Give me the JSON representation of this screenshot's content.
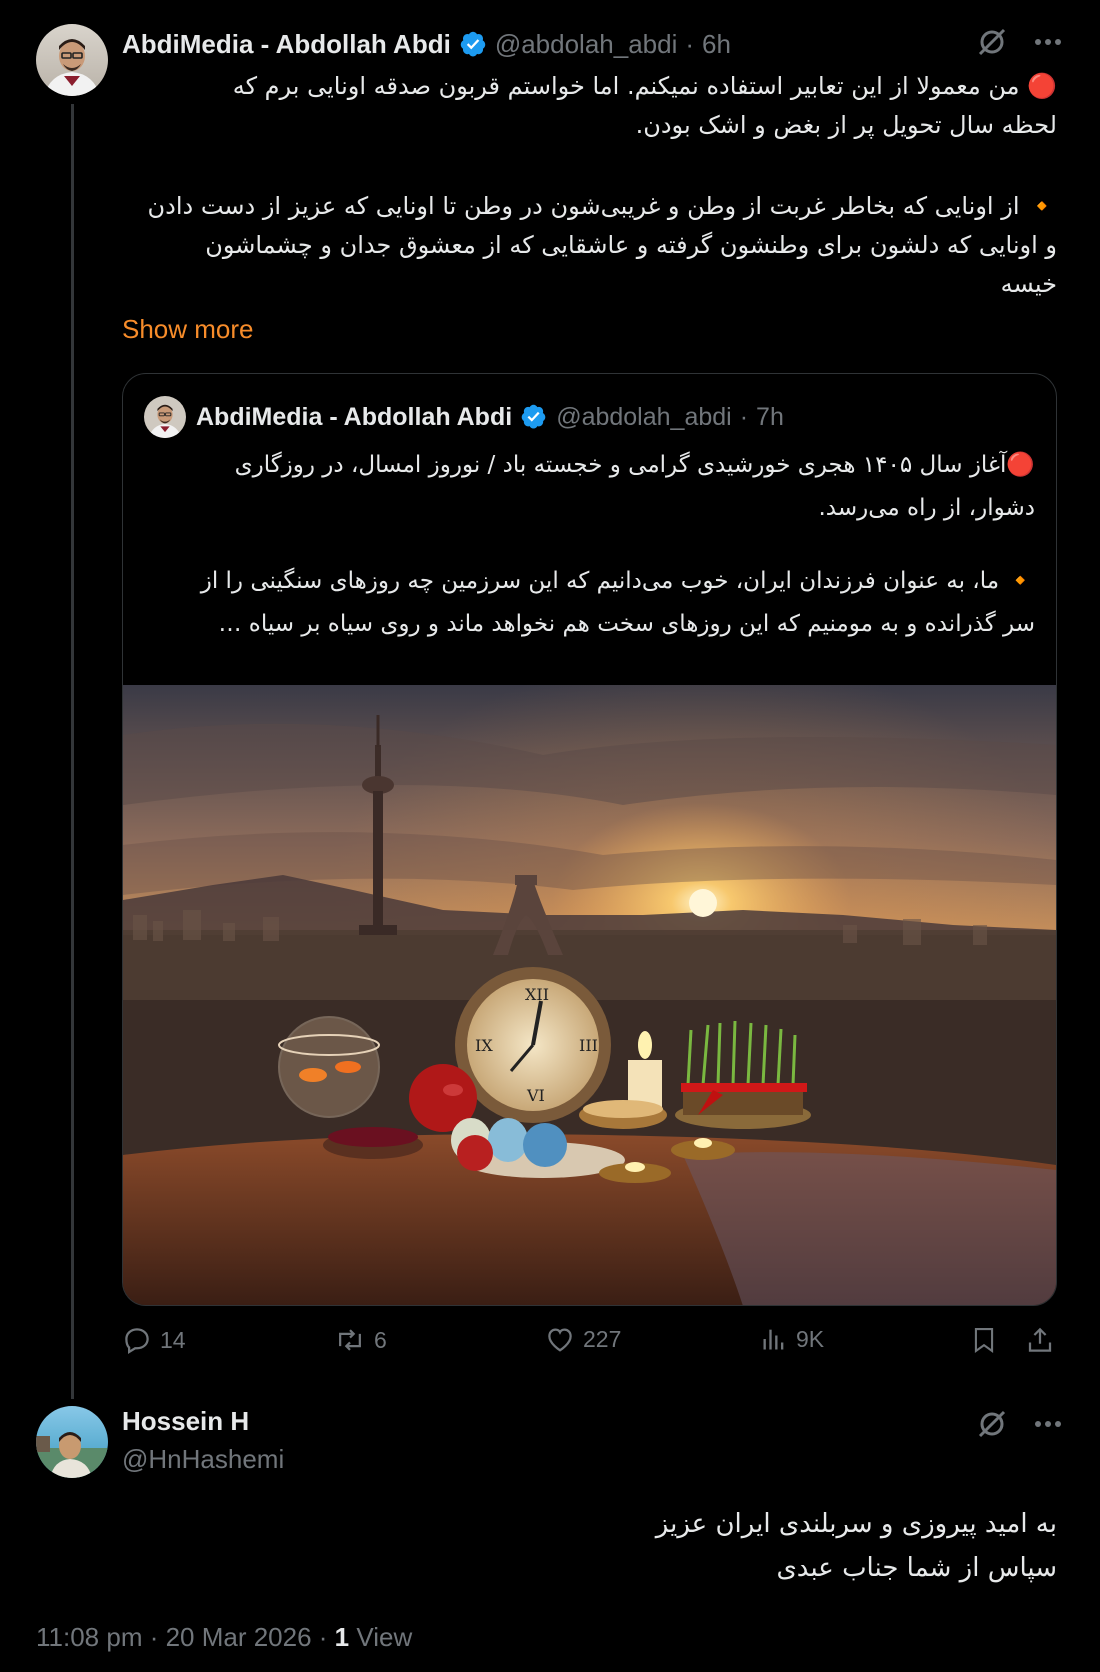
{
  "post": {
    "author_name": "AbdiMedia - Abdollah Abdi",
    "handle": "@abdolah_abdi",
    "separator": "·",
    "time": "6h",
    "lines": [
      "🔴 من معمولا از این تعابیر استفاده نمیکنم. اما خواستم قربون صدقه اونایی برم که",
      "لحظه سال تحویل پر از بغض و اشک بودن.",
      "🔸 از اونایی که بخاطر غربت از وطن و غریبی‌شون در وطن تا اونایی که عزیز از دست دادن",
      "و اونایی که دلشون برای وطنشون گرفته و عاشقایی که از معشوق جدان و چشماشون",
      "خیسه"
    ],
    "show_more": "Show more"
  },
  "quote": {
    "author_name": "AbdiMedia - Abdollah Abdi",
    "handle": "@abdolah_abdi",
    "separator": "·",
    "time": "7h",
    "lines": [
      "🔴آغاز سال ۱۴۰۵ هجری خورشیدی گرامی و خجسته باد / نوروز امسال، در روزگاری",
      "دشوار، از راه می‌رسد.",
      "🔸 ما، به عنوان فرزندان ایران، خوب می‌دانیم که این سرزمین چه روزهای سنگینی را از",
      "سر گذرانده و به مومنیم که این روزهای سخت هم نخواهد ماند و روی سیاه بر سیاه …"
    ]
  },
  "actions": {
    "replies": "14",
    "reposts": "6",
    "likes": "227",
    "views": "9K"
  },
  "reply": {
    "author_name": "Hossein H",
    "handle": "@HnHashemi",
    "lines": [
      "به امید پیروزی و سربلندی ایران عزیز",
      "سپاس از شما جناب عبدی"
    ],
    "timestamp": "11:08 pm · 20 Mar 2026 · ",
    "view_count": "1",
    "view_label": " View"
  },
  "colors": {
    "accent": "#f78c2a",
    "verified": "#1d9bf0",
    "muted": "#71767b",
    "text": "#e7e9ea",
    "border": "#2f3336"
  }
}
